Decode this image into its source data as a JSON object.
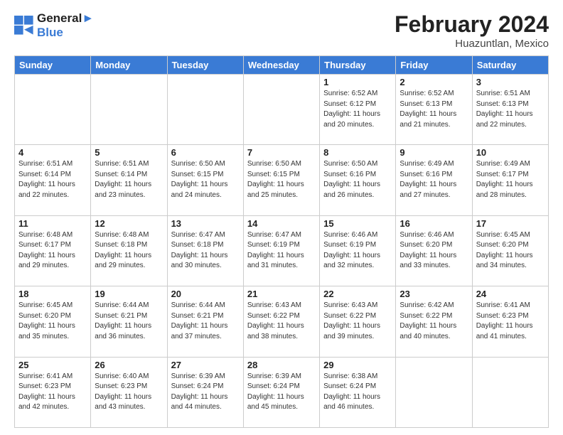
{
  "header": {
    "logo_line1": "General",
    "logo_line2": "Blue",
    "month": "February 2024",
    "location": "Huazuntlan, Mexico"
  },
  "days_of_week": [
    "Sunday",
    "Monday",
    "Tuesday",
    "Wednesday",
    "Thursday",
    "Friday",
    "Saturday"
  ],
  "weeks": [
    [
      {
        "day": "",
        "info": ""
      },
      {
        "day": "",
        "info": ""
      },
      {
        "day": "",
        "info": ""
      },
      {
        "day": "",
        "info": ""
      },
      {
        "day": "1",
        "info": "Sunrise: 6:52 AM\nSunset: 6:12 PM\nDaylight: 11 hours and 20 minutes."
      },
      {
        "day": "2",
        "info": "Sunrise: 6:52 AM\nSunset: 6:13 PM\nDaylight: 11 hours and 21 minutes."
      },
      {
        "day": "3",
        "info": "Sunrise: 6:51 AM\nSunset: 6:13 PM\nDaylight: 11 hours and 22 minutes."
      }
    ],
    [
      {
        "day": "4",
        "info": "Sunrise: 6:51 AM\nSunset: 6:14 PM\nDaylight: 11 hours and 22 minutes."
      },
      {
        "day": "5",
        "info": "Sunrise: 6:51 AM\nSunset: 6:14 PM\nDaylight: 11 hours and 23 minutes."
      },
      {
        "day": "6",
        "info": "Sunrise: 6:50 AM\nSunset: 6:15 PM\nDaylight: 11 hours and 24 minutes."
      },
      {
        "day": "7",
        "info": "Sunrise: 6:50 AM\nSunset: 6:15 PM\nDaylight: 11 hours and 25 minutes."
      },
      {
        "day": "8",
        "info": "Sunrise: 6:50 AM\nSunset: 6:16 PM\nDaylight: 11 hours and 26 minutes."
      },
      {
        "day": "9",
        "info": "Sunrise: 6:49 AM\nSunset: 6:16 PM\nDaylight: 11 hours and 27 minutes."
      },
      {
        "day": "10",
        "info": "Sunrise: 6:49 AM\nSunset: 6:17 PM\nDaylight: 11 hours and 28 minutes."
      }
    ],
    [
      {
        "day": "11",
        "info": "Sunrise: 6:48 AM\nSunset: 6:17 PM\nDaylight: 11 hours and 29 minutes."
      },
      {
        "day": "12",
        "info": "Sunrise: 6:48 AM\nSunset: 6:18 PM\nDaylight: 11 hours and 29 minutes."
      },
      {
        "day": "13",
        "info": "Sunrise: 6:47 AM\nSunset: 6:18 PM\nDaylight: 11 hours and 30 minutes."
      },
      {
        "day": "14",
        "info": "Sunrise: 6:47 AM\nSunset: 6:19 PM\nDaylight: 11 hours and 31 minutes."
      },
      {
        "day": "15",
        "info": "Sunrise: 6:46 AM\nSunset: 6:19 PM\nDaylight: 11 hours and 32 minutes."
      },
      {
        "day": "16",
        "info": "Sunrise: 6:46 AM\nSunset: 6:20 PM\nDaylight: 11 hours and 33 minutes."
      },
      {
        "day": "17",
        "info": "Sunrise: 6:45 AM\nSunset: 6:20 PM\nDaylight: 11 hours and 34 minutes."
      }
    ],
    [
      {
        "day": "18",
        "info": "Sunrise: 6:45 AM\nSunset: 6:20 PM\nDaylight: 11 hours and 35 minutes."
      },
      {
        "day": "19",
        "info": "Sunrise: 6:44 AM\nSunset: 6:21 PM\nDaylight: 11 hours and 36 minutes."
      },
      {
        "day": "20",
        "info": "Sunrise: 6:44 AM\nSunset: 6:21 PM\nDaylight: 11 hours and 37 minutes."
      },
      {
        "day": "21",
        "info": "Sunrise: 6:43 AM\nSunset: 6:22 PM\nDaylight: 11 hours and 38 minutes."
      },
      {
        "day": "22",
        "info": "Sunrise: 6:43 AM\nSunset: 6:22 PM\nDaylight: 11 hours and 39 minutes."
      },
      {
        "day": "23",
        "info": "Sunrise: 6:42 AM\nSunset: 6:22 PM\nDaylight: 11 hours and 40 minutes."
      },
      {
        "day": "24",
        "info": "Sunrise: 6:41 AM\nSunset: 6:23 PM\nDaylight: 11 hours and 41 minutes."
      }
    ],
    [
      {
        "day": "25",
        "info": "Sunrise: 6:41 AM\nSunset: 6:23 PM\nDaylight: 11 hours and 42 minutes."
      },
      {
        "day": "26",
        "info": "Sunrise: 6:40 AM\nSunset: 6:23 PM\nDaylight: 11 hours and 43 minutes."
      },
      {
        "day": "27",
        "info": "Sunrise: 6:39 AM\nSunset: 6:24 PM\nDaylight: 11 hours and 44 minutes."
      },
      {
        "day": "28",
        "info": "Sunrise: 6:39 AM\nSunset: 6:24 PM\nDaylight: 11 hours and 45 minutes."
      },
      {
        "day": "29",
        "info": "Sunrise: 6:38 AM\nSunset: 6:24 PM\nDaylight: 11 hours and 46 minutes."
      },
      {
        "day": "",
        "info": ""
      },
      {
        "day": "",
        "info": ""
      }
    ]
  ]
}
